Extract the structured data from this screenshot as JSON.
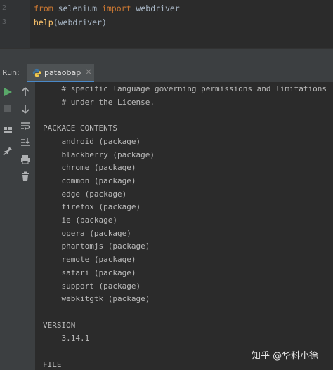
{
  "editor": {
    "lines": [
      {
        "number": "2",
        "keyword1": "from",
        "middle": " selenium ",
        "keyword2": "import",
        "rest": " webdriver"
      },
      {
        "number": "3",
        "func": "help",
        "args": "(webdriver",
        "close": ")"
      }
    ]
  },
  "run_panel": {
    "label": "Run:",
    "tab": {
      "name": "pataobap",
      "close": "×"
    }
  },
  "toolbar": {
    "left": [
      "rerun-icon",
      "stop-icon",
      "layout-icon",
      "pin-icon"
    ],
    "right": [
      "up-arrow-icon",
      "down-arrow-icon",
      "soft-wrap-icon",
      "scroll-to-end-icon",
      "print-icon",
      "trash-icon"
    ]
  },
  "console": {
    "lines": [
      "    # specific language governing permissions and limitations",
      "    # under the License.",
      "",
      "PACKAGE CONTENTS",
      "    android (package)",
      "    blackberry (package)",
      "    chrome (package)",
      "    common (package)",
      "    edge (package)",
      "    firefox (package)",
      "    ie (package)",
      "    opera (package)",
      "    phantomjs (package)",
      "    remote (package)",
      "    safari (package)",
      "    support (package)",
      "    webkitgtk (package)",
      "",
      "VERSION",
      "    3.14.1",
      "",
      "FILE"
    ]
  },
  "watermark": "知乎 @华科小徐",
  "colors": {
    "keyword": "#cc7832",
    "function": "#ffc66d",
    "text": "#a9b7c6",
    "run_green": "#59a869"
  }
}
